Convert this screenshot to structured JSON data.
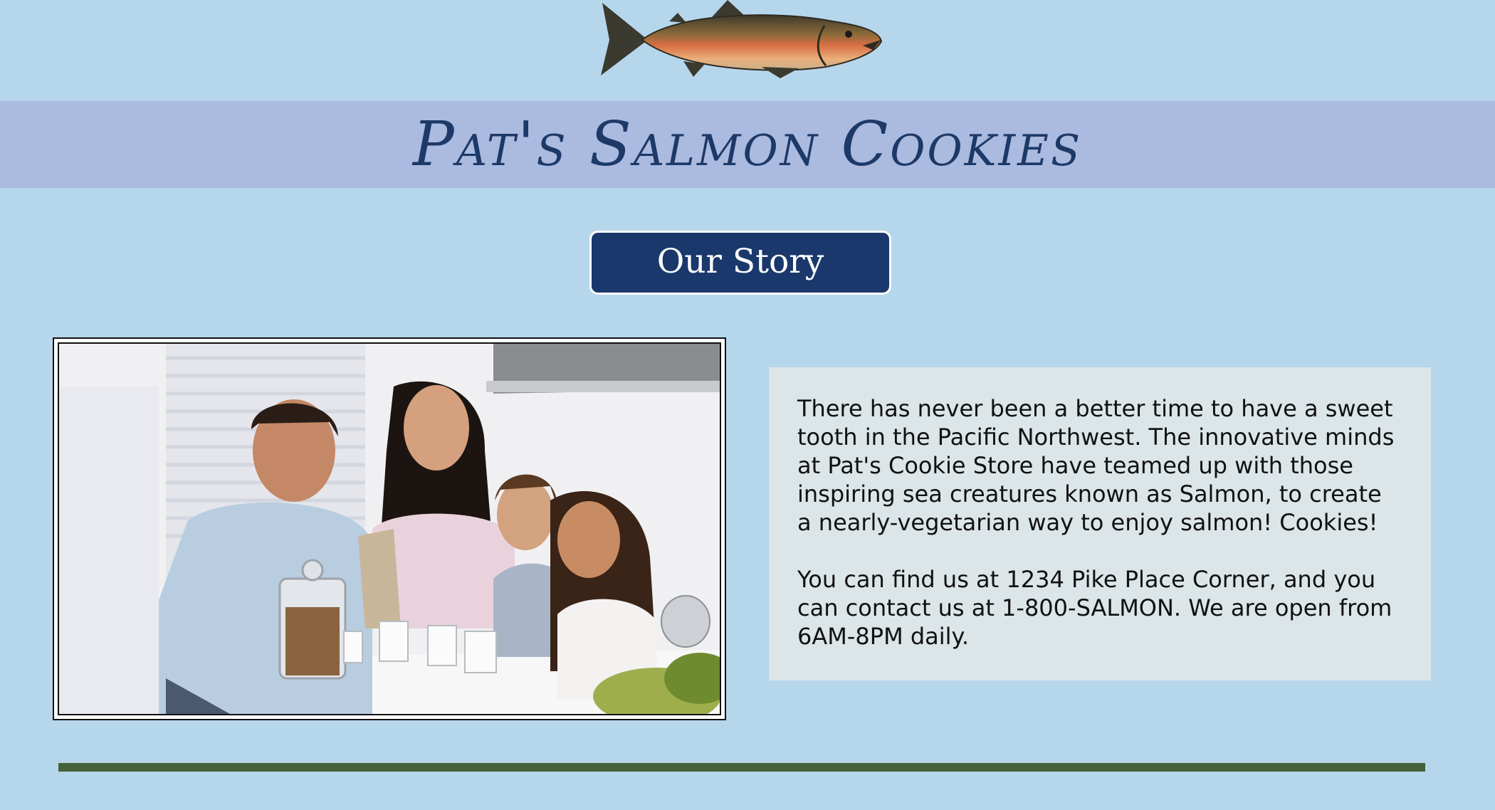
{
  "header": {
    "logo_icon": "salmon-fish-icon",
    "title": "Pat's Salmon Cookies"
  },
  "nav": {
    "story_button_label": "Our Story"
  },
  "main": {
    "photo_alt": "Family smiling at a kitchen counter with cookies and milk",
    "paragraphs": [
      "There has never been a better time to have a sweet tooth in the Pacific Northwest. The innovative minds at Pat's Cookie Store have teamed up with those inspiring sea creatures known as Salmon, to create a nearly-vegetarian way to enjoy salmon! Cookies!",
      "You can find us at 1234 Pike Place Corner, and you can contact us at 1-800-SALMON. We are open from 6AM-8PM daily."
    ]
  },
  "colors": {
    "page_background": "#b6d6ec",
    "banner_background": "#abbadf",
    "title_color": "#1c3968",
    "button_background": "#1a386b",
    "info_background": "#dce5e8",
    "footer_rule": "#44613a"
  }
}
